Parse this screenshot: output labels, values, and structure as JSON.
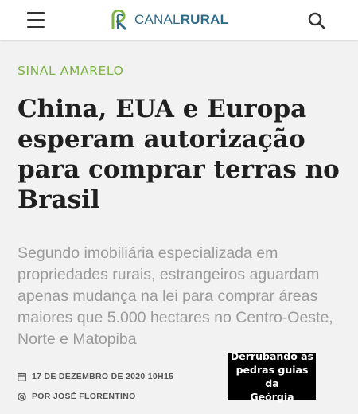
{
  "header": {
    "logo": {
      "text_light": "CANAL",
      "text_bold": "RURAL"
    },
    "menu_icon": "hamburger-menu-icon",
    "search_icon": "search-icon"
  },
  "article": {
    "kicker": "SINAL AMARELO",
    "headline": "China, EUA e Europa esperam autorização para comprar terras no Brasil",
    "subtitle": "Segundo imobiliária especializada em propriedades rurais, estrangeiros aguardam apenas mudança na lei para comprar áreas maiores que 5.000 hectares no Centro-Oeste, Norte e Matopiba",
    "date": "17 DE DEZEMBRO DE 2020 10H15",
    "author": "POR JOSÉ FLORENTINO"
  },
  "overlay_caption": {
    "line1": "Derrubando as",
    "line2": "pedras guias da",
    "line3": "Geórgia"
  },
  "colors": {
    "kicker": "#7cb342",
    "brand": "#2f6b8a",
    "headline": "#202020",
    "subtitle": "#9a9a9a"
  }
}
